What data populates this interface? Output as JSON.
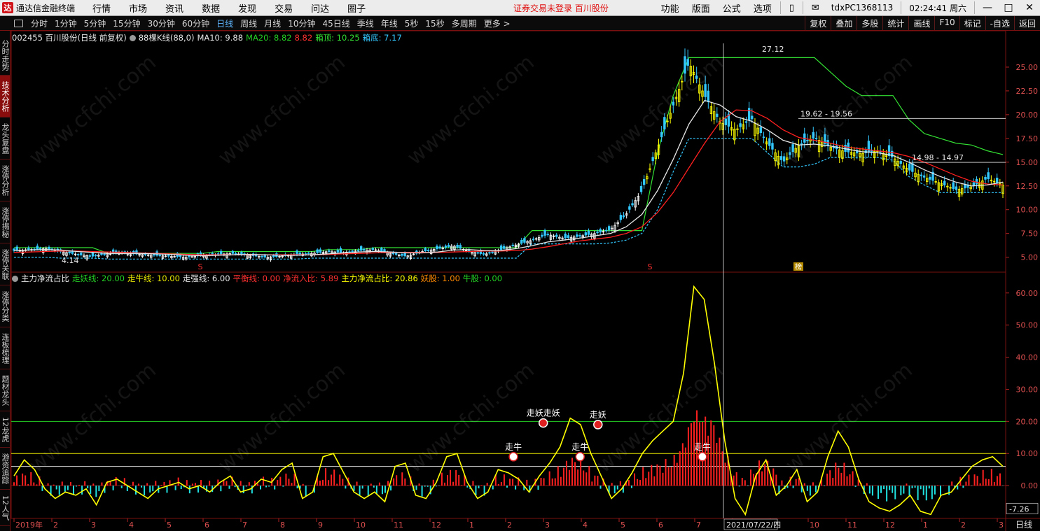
{
  "app": {
    "title": "通达信金融终端",
    "logo_glyph": "达"
  },
  "menu": [
    "行情",
    "市场",
    "资讯",
    "数据",
    "发现",
    "交易",
    "问达",
    "圈子"
  ],
  "notice": "证券交易未登录  百川股份",
  "right_menu": [
    "功能",
    "版面",
    "公式",
    "选项"
  ],
  "user": "tdxPC1368113",
  "clock": "02:24:41 周六",
  "periods": [
    "分时",
    "1分钟",
    "5分钟",
    "15分钟",
    "30分钟",
    "60分钟",
    "日线",
    "周线",
    "月线",
    "10分钟",
    "45日线",
    "季线",
    "年线",
    "5秒",
    "15秒",
    "多周期",
    "更多 >"
  ],
  "active_period": "日线",
  "tools": [
    "复权",
    "叠加",
    "多股",
    "统计",
    "画线",
    "F10",
    "标记",
    "-自选",
    "返回"
  ],
  "left_tabs": [
    "分时走势",
    "技术分析",
    "龙头复盘",
    "涨停分析",
    "涨停揭秘",
    "涨停关联",
    "涨停分类",
    "连板梳理",
    "题材龙头",
    "12龙虎",
    "游资追踪",
    "12人气"
  ],
  "active_left_tab": "技术分析",
  "price_info": {
    "stock": "002455 百川股份(日线 前复权)",
    "indicator": "88棵K线(88,0)",
    "ma10": "MA10: 9.88",
    "ma20": "MA20: 8.82",
    "ma_extra": "8.82",
    "box_top": "箱顶: 10.25",
    "box_bottom": "箱底: 7.17",
    "colors": {
      "ma10": "#e6e6e6",
      "ma20": "#24d024",
      "extra": "#ff3030",
      "box_top": "#33e033",
      "box_bottom": "#33c8ff"
    }
  },
  "flow_info": {
    "title": "主力净流占比",
    "items": [
      {
        "text": "走妖线: 20.00",
        "color": "#24d024"
      },
      {
        "text": "走牛线: 10.00",
        "color": "#e6e600"
      },
      {
        "text": "走强线: 6.00",
        "color": "#e6e6e6"
      },
      {
        "text": "平衡线: 0.00",
        "color": "#ff3030"
      },
      {
        "text": "净流入比: 5.89",
        "color": "#ff3030"
      },
      {
        "text": "主力净流占比: 20.86",
        "color": "#ffff00"
      },
      {
        "text": "妖股: 1.00",
        "color": "#ff8a00"
      },
      {
        "text": "牛股: 0.00",
        "color": "#24d024"
      }
    ]
  },
  "annotations": {
    "price_high": "27.12",
    "price_low": "4.14",
    "level1": "19.62 - 19.56",
    "level2": "14.98 - 14.97",
    "cursor_date": "2021/07/22/四",
    "current_value": "-7.26",
    "period_label": "日线",
    "s_marker": "S",
    "bang_marker": "榜",
    "signals": [
      "走牛",
      "走妖",
      "走妖走妖",
      "走牛",
      "走妖",
      "走牛"
    ]
  },
  "chart_data": [
    {
      "type": "candlestick",
      "title": "002455 百川股份(日线 前复权)",
      "y_ticks": [
        "25.00",
        "22.50",
        "20.00",
        "17.50",
        "15.00",
        "12.50",
        "10.00",
        "7.50",
        "5.00"
      ],
      "ylim": [
        3.5,
        27.5
      ],
      "x_ticks": [
        "2019年",
        "2",
        "3",
        "4",
        "5",
        "6",
        "7",
        "8",
        "9",
        "10",
        "11",
        "12",
        "1",
        "2",
        "3",
        "4",
        "5",
        "6",
        "7",
        "8",
        "9",
        "10",
        "11",
        "12",
        "1",
        "2",
        "3"
      ],
      "close": [
        5.7,
        5.8,
        5.9,
        5.6,
        5.3,
        5.1,
        5.4,
        5.5,
        5.3,
        5.2,
        5.1,
        5.0,
        5.2,
        5.3,
        5.4,
        5.2,
        5.0,
        5.1,
        5.3,
        5.4,
        5.6,
        5.5,
        5.7,
        5.8,
        5.4,
        5.1,
        5.6,
        5.9,
        6.2,
        5.6,
        5.3,
        5.8,
        6.3,
        6.8,
        7.4,
        7.0,
        7.2,
        7.5,
        7.9,
        9.5,
        12.0,
        16.5,
        21.0,
        25.5,
        22.0,
        19.2,
        18.4,
        19.6,
        17.0,
        15.0,
        16.8,
        17.6,
        16.6,
        16.1,
        15.9,
        16.2,
        15.5,
        14.2,
        13.4,
        12.8,
        12.1,
        12.4,
        13.3,
        12.6
      ],
      "ma10": [
        5.7,
        5.75,
        5.8,
        5.75,
        5.6,
        5.5,
        5.4,
        5.4,
        5.4,
        5.35,
        5.3,
        5.2,
        5.15,
        5.2,
        5.25,
        5.3,
        5.25,
        5.2,
        5.2,
        5.25,
        5.35,
        5.45,
        5.55,
        5.6,
        5.55,
        5.45,
        5.45,
        5.55,
        5.75,
        5.8,
        5.7,
        5.7,
        5.9,
        6.2,
        6.6,
        6.8,
        7.0,
        7.25,
        7.5,
        8.2,
        9.5,
        12.0,
        15.3,
        19.0,
        21.5,
        21.0,
        19.8,
        19.3,
        18.4,
        17.3,
        16.8,
        16.9,
        16.7,
        16.4,
        16.1,
        16.0,
        15.7,
        15.0,
        14.2,
        13.5,
        12.9,
        12.5,
        12.6,
        12.9
      ],
      "ma20": [
        5.5,
        5.55,
        5.6,
        5.65,
        5.65,
        5.6,
        5.55,
        5.5,
        5.45,
        5.4,
        5.35,
        5.3,
        5.25,
        5.25,
        5.25,
        5.25,
        5.25,
        5.25,
        5.25,
        5.25,
        5.3,
        5.35,
        5.4,
        5.45,
        5.5,
        5.5,
        5.5,
        5.5,
        5.55,
        5.6,
        5.65,
        5.65,
        5.7,
        5.85,
        6.1,
        6.4,
        6.7,
        6.9,
        7.1,
        7.5,
        8.2,
        9.7,
        11.8,
        14.4,
        17.0,
        19.3,
        20.5,
        20.4,
        19.6,
        18.4,
        17.6,
        17.3,
        17.0,
        16.6,
        16.4,
        16.2,
        16.0,
        15.6,
        15.0,
        14.3,
        13.6,
        13.0,
        12.7,
        12.6
      ],
      "box_top": [
        6.0,
        6.0,
        6.0,
        6.0,
        6.0,
        6.0,
        5.4,
        5.4,
        5.4,
        5.4,
        5.4,
        5.4,
        5.4,
        5.6,
        5.6,
        5.6,
        5.6,
        5.6,
        5.6,
        5.6,
        5.8,
        5.8,
        5.8,
        6.0,
        6.0,
        6.0,
        6.0,
        6.0,
        6.0,
        6.0,
        6.0,
        6.0,
        6.0,
        7.8,
        7.8,
        7.8,
        7.8,
        7.8,
        7.8,
        7.8,
        7.8,
        16.0,
        22.0,
        26.0,
        26.0,
        26.0,
        26.0,
        26.0,
        26.0,
        26.0,
        26.0,
        26.0,
        24.5,
        23.0,
        22.0,
        22.0,
        22.0,
        19.5,
        18.0,
        17.5,
        17.0,
        16.8,
        16.2,
        15.8
      ],
      "box_bottom": [
        5.0,
        5.0,
        5.0,
        4.9,
        4.9,
        4.9,
        4.8,
        4.8,
        4.8,
        4.8,
        4.8,
        4.8,
        4.8,
        4.8,
        4.8,
        4.8,
        4.8,
        4.8,
        4.8,
        4.9,
        4.9,
        4.9,
        4.9,
        4.9,
        4.9,
        4.9,
        4.9,
        4.9,
        4.9,
        4.9,
        4.9,
        4.9,
        4.9,
        6.4,
        6.4,
        6.4,
        6.4,
        6.4,
        6.5,
        6.8,
        7.5,
        10.0,
        14.0,
        17.5,
        17.5,
        17.5,
        17.5,
        17.5,
        16.0,
        14.5,
        14.5,
        14.8,
        15.5,
        15.5,
        15.5,
        15.5,
        15.2,
        13.5,
        12.6,
        11.8,
        11.8,
        11.8,
        11.8,
        11.8
      ]
    },
    {
      "type": "line",
      "title": "主力净流占比",
      "y_ticks": [
        "60.00",
        "50.00",
        "40.00",
        "30.00",
        "20.00",
        "10.00",
        "0.00"
      ],
      "ylim": [
        -10,
        63
      ],
      "reference_lines": {
        "走妖线": 20,
        "走牛线": 10,
        "走强线": 6,
        "平衡线": 0
      },
      "line": [
        3,
        8,
        5,
        -1,
        -4,
        -2,
        -3,
        -1,
        -6,
        1,
        2,
        0,
        -2,
        -4,
        -1,
        0,
        1,
        -1,
        0,
        -2,
        1,
        3,
        -2,
        -1,
        2,
        1,
        5,
        7,
        -4,
        -2,
        9,
        10,
        4,
        -2,
        -4,
        -2,
        -5,
        6,
        7,
        -3,
        -4,
        1,
        9,
        10,
        1,
        -4,
        -2,
        5,
        4,
        2,
        -2,
        3,
        7,
        12,
        21,
        19,
        10,
        3,
        -4,
        -1,
        4,
        10,
        14,
        17,
        20,
        35,
        62,
        58,
        38,
        14,
        -4,
        -9,
        3,
        8,
        -3,
        0,
        5,
        -5,
        -2,
        9,
        17,
        12,
        2,
        -5,
        -7,
        -8,
        -6,
        -3,
        -8,
        -9,
        -3,
        -2,
        2,
        6,
        8,
        9,
        6
      ],
      "markers": [
        {
          "label": "走牛",
          "x": 0.505,
          "value": 9
        },
        {
          "label": "走妖走妖",
          "x": 0.535,
          "value": 19.5
        },
        {
          "label": "走牛",
          "x": 0.572,
          "value": 9
        },
        {
          "label": "走妖",
          "x": 0.59,
          "value": 19
        },
        {
          "label": "走牛",
          "x": 0.695,
          "value": 9
        }
      ]
    }
  ]
}
